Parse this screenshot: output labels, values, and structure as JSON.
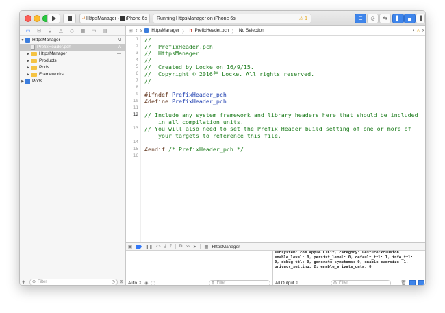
{
  "toolbar": {
    "scheme_name": "HttpsManager",
    "device_name": "iPhone 6s",
    "status_text": "Running HttpsManager on iPhone 6s",
    "warning_count": "1"
  },
  "navigator": {
    "items": [
      {
        "label": "HttpsManager",
        "flag": "M"
      },
      {
        "label": "PrefixHeader.pch",
        "flag": "A"
      },
      {
        "label": "HttpsManager",
        "flag": "—"
      },
      {
        "label": "Products",
        "flag": ""
      },
      {
        "label": "Pods",
        "flag": ""
      },
      {
        "label": "Frameworks",
        "flag": ""
      },
      {
        "label": "Pods",
        "flag": ""
      }
    ],
    "filter_placeholder": "Filter"
  },
  "jumpbar": {
    "project": "HttpsManager",
    "file": "PrefixHeader.pch",
    "selection": "No Selection"
  },
  "code": {
    "current_line": "12",
    "lines": [
      {
        "n": "1",
        "text": "//"
      },
      {
        "n": "2",
        "text": "//  PrefixHeader.pch"
      },
      {
        "n": "3",
        "text": "//  HttpsManager"
      },
      {
        "n": "4",
        "text": "//"
      },
      {
        "n": "5",
        "text": "//  Created by Locke on 16/9/15."
      },
      {
        "n": "6",
        "text": "//  Copyright © 2016年 Locke. All rights reserved."
      },
      {
        "n": "7",
        "text": "//"
      },
      {
        "n": "8",
        "text": ""
      },
      {
        "n": "9",
        "text": "#ifndef PrefixHeader_pch"
      },
      {
        "n": "10",
        "text": "#define PrefixHeader_pch"
      },
      {
        "n": "11",
        "text": ""
      },
      {
        "n": "12",
        "text": "// Include any system framework and library headers here that should be included"
      },
      {
        "n": "",
        "text": "    in all compilation units."
      },
      {
        "n": "13",
        "text": "// You will also need to set the Prefix Header build setting of one or more of"
      },
      {
        "n": "",
        "text": "    your targets to reference this file."
      },
      {
        "n": "14",
        "text": ""
      },
      {
        "n": "15",
        "text": "#endif /* PrefixHeader_pch */"
      },
      {
        "n": "16",
        "text": ""
      }
    ]
  },
  "debug": {
    "process_label": "HttpsManager",
    "console_lines": [
      "subsystem: com.apple.UIKit, category: GestureExclusion,",
      "enable_level: 0, persist_level: 0, default_ttl: 1, info_ttl:",
      "0, debug_ttl: 0, generate_symptoms: 0, enable_oversize: 1,",
      "privacy_setting: 2, enable_private_data: 0"
    ],
    "vars_scope": "Auto",
    "vars_filter_placeholder": "Filter",
    "output_scope": "All Output",
    "console_filter_placeholder": "Filter"
  }
}
